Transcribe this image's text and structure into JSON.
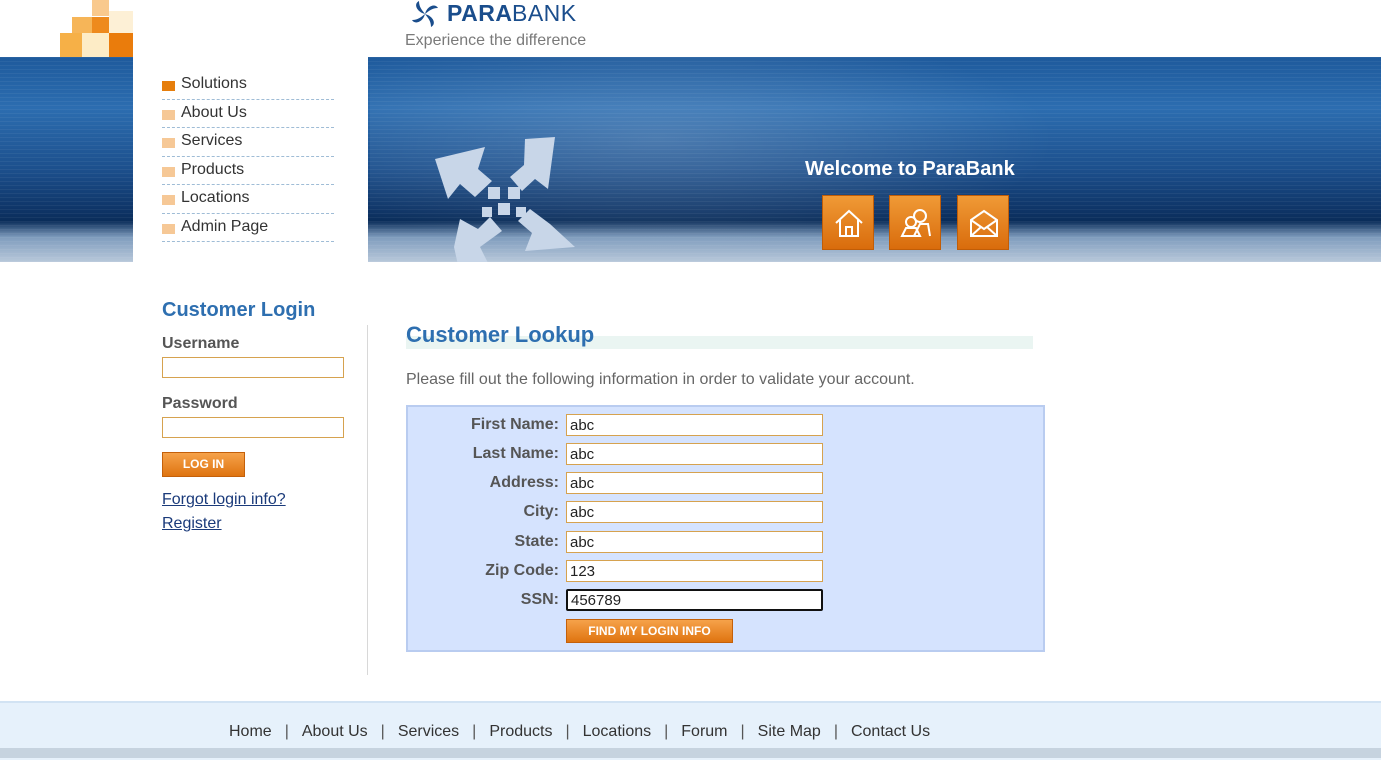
{
  "brand": {
    "name_bold": "PARA",
    "name_light": "BANK",
    "tagline": "Experience the difference"
  },
  "header": {
    "welcome": "Welcome to ParaBank"
  },
  "nav": {
    "items": [
      {
        "label": "Solutions"
      },
      {
        "label": "About Us"
      },
      {
        "label": "Services"
      },
      {
        "label": "Products"
      },
      {
        "label": "Locations"
      },
      {
        "label": "Admin Page"
      }
    ]
  },
  "login": {
    "title": "Customer Login",
    "username_label": "Username",
    "username_value": "",
    "password_label": "Password",
    "password_value": "",
    "button": "LOG IN",
    "forgot": "Forgot login info?",
    "register": "Register"
  },
  "lookup": {
    "title": "Customer Lookup",
    "intro": "Please fill out the following information in order to validate your account.",
    "fields": [
      {
        "label": "First Name:",
        "value": "abc"
      },
      {
        "label": "Last Name:",
        "value": "abc"
      },
      {
        "label": "Address:",
        "value": "abc"
      },
      {
        "label": "City:",
        "value": "abc"
      },
      {
        "label": "State:",
        "value": "abc"
      },
      {
        "label": "Zip Code:",
        "value": "123"
      },
      {
        "label": "SSN:",
        "value": "456789"
      }
    ],
    "button": "FIND MY LOGIN INFO"
  },
  "footer": {
    "links": [
      "Home",
      "About Us",
      "Services",
      "Products",
      "Locations",
      "Forum",
      "Site Map",
      "Contact Us"
    ],
    "separator": "|"
  },
  "icons": {
    "home": "home-icon",
    "about": "people-icon",
    "contact": "envelope-icon"
  },
  "colors": {
    "accent_orange": "#e67e0c",
    "title_blue": "#2e6fb0",
    "form_bg": "#d5e3fe"
  }
}
